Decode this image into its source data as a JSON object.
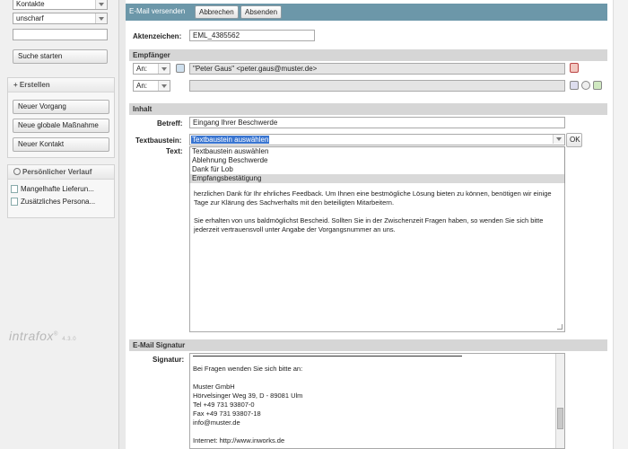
{
  "sidebar": {
    "filter_type": "Kontakte",
    "filter_mode": "unscharf",
    "search_value": "",
    "search_button": "Suche starten",
    "create_header": "+ Erstellen",
    "create_buttons": [
      "Neuer Vorgang",
      "Neue globale Maßnahme",
      "Neuer Kontakt"
    ],
    "history_header": "Persönlicher Verlauf",
    "history_items": [
      "Mangelhafte Lieferun...",
      "Zusätzliches Persona..."
    ],
    "logo_text": "intrafox",
    "logo_version": "4.3.0"
  },
  "toolbar": {
    "title": "E-Mail versenden",
    "cancel_label": "Abbrechen",
    "send_label": "Absenden"
  },
  "file_number": {
    "label": "Aktenzeichen:",
    "value": "EML_4385562"
  },
  "recipients": {
    "header": "Empfänger",
    "rows": [
      {
        "type": "An:",
        "value": "\"Peter Gaus\" <peter.gaus@muster.de>"
      },
      {
        "type": "An:",
        "value": ""
      }
    ]
  },
  "content": {
    "header": "Inhalt",
    "subject_label": "Betreff:",
    "subject_value": "Eingang Ihrer Beschwerde",
    "template_label": "Textbaustein:",
    "template_value": "Textbaustein auswählen",
    "ok_label": "OK",
    "text_label": "Text:",
    "template_options": [
      "Textbaustein auswählen",
      "Ablehnung Beschwerde",
      "Dank für Lob",
      "Empfangsbestätigung"
    ],
    "body_paragraphs": [
      "herzlichen Dank für Ihr ehrliches Feedback. Um Ihnen eine bestmögliche Lösung bieten zu können, benötigen wir einige Tage zur Klärung des Sachverhalts mit den beteiligten Mitarbeitern.",
      "Sie erhalten von uns baldmöglichst Bescheid. Sollten Sie in der Zwischenzeit Fragen haben, so wenden Sie sich bitte jederzeit vertrauensvoll unter Angabe der Vorgangsnummer an uns."
    ]
  },
  "signature": {
    "header": "E-Mail Signatur",
    "label": "Signatur:",
    "lines": [
      "Bei Fragen wenden Sie sich bitte an:",
      "",
      "Muster GmbH",
      "Hörvelsinger Weg 39, D - 89081 Ulm",
      "Tel +49 731 93807-0",
      "Fax +49 731 93807-18",
      "info@muster.de",
      "",
      "Internet: http://www.inworks.de"
    ]
  }
}
